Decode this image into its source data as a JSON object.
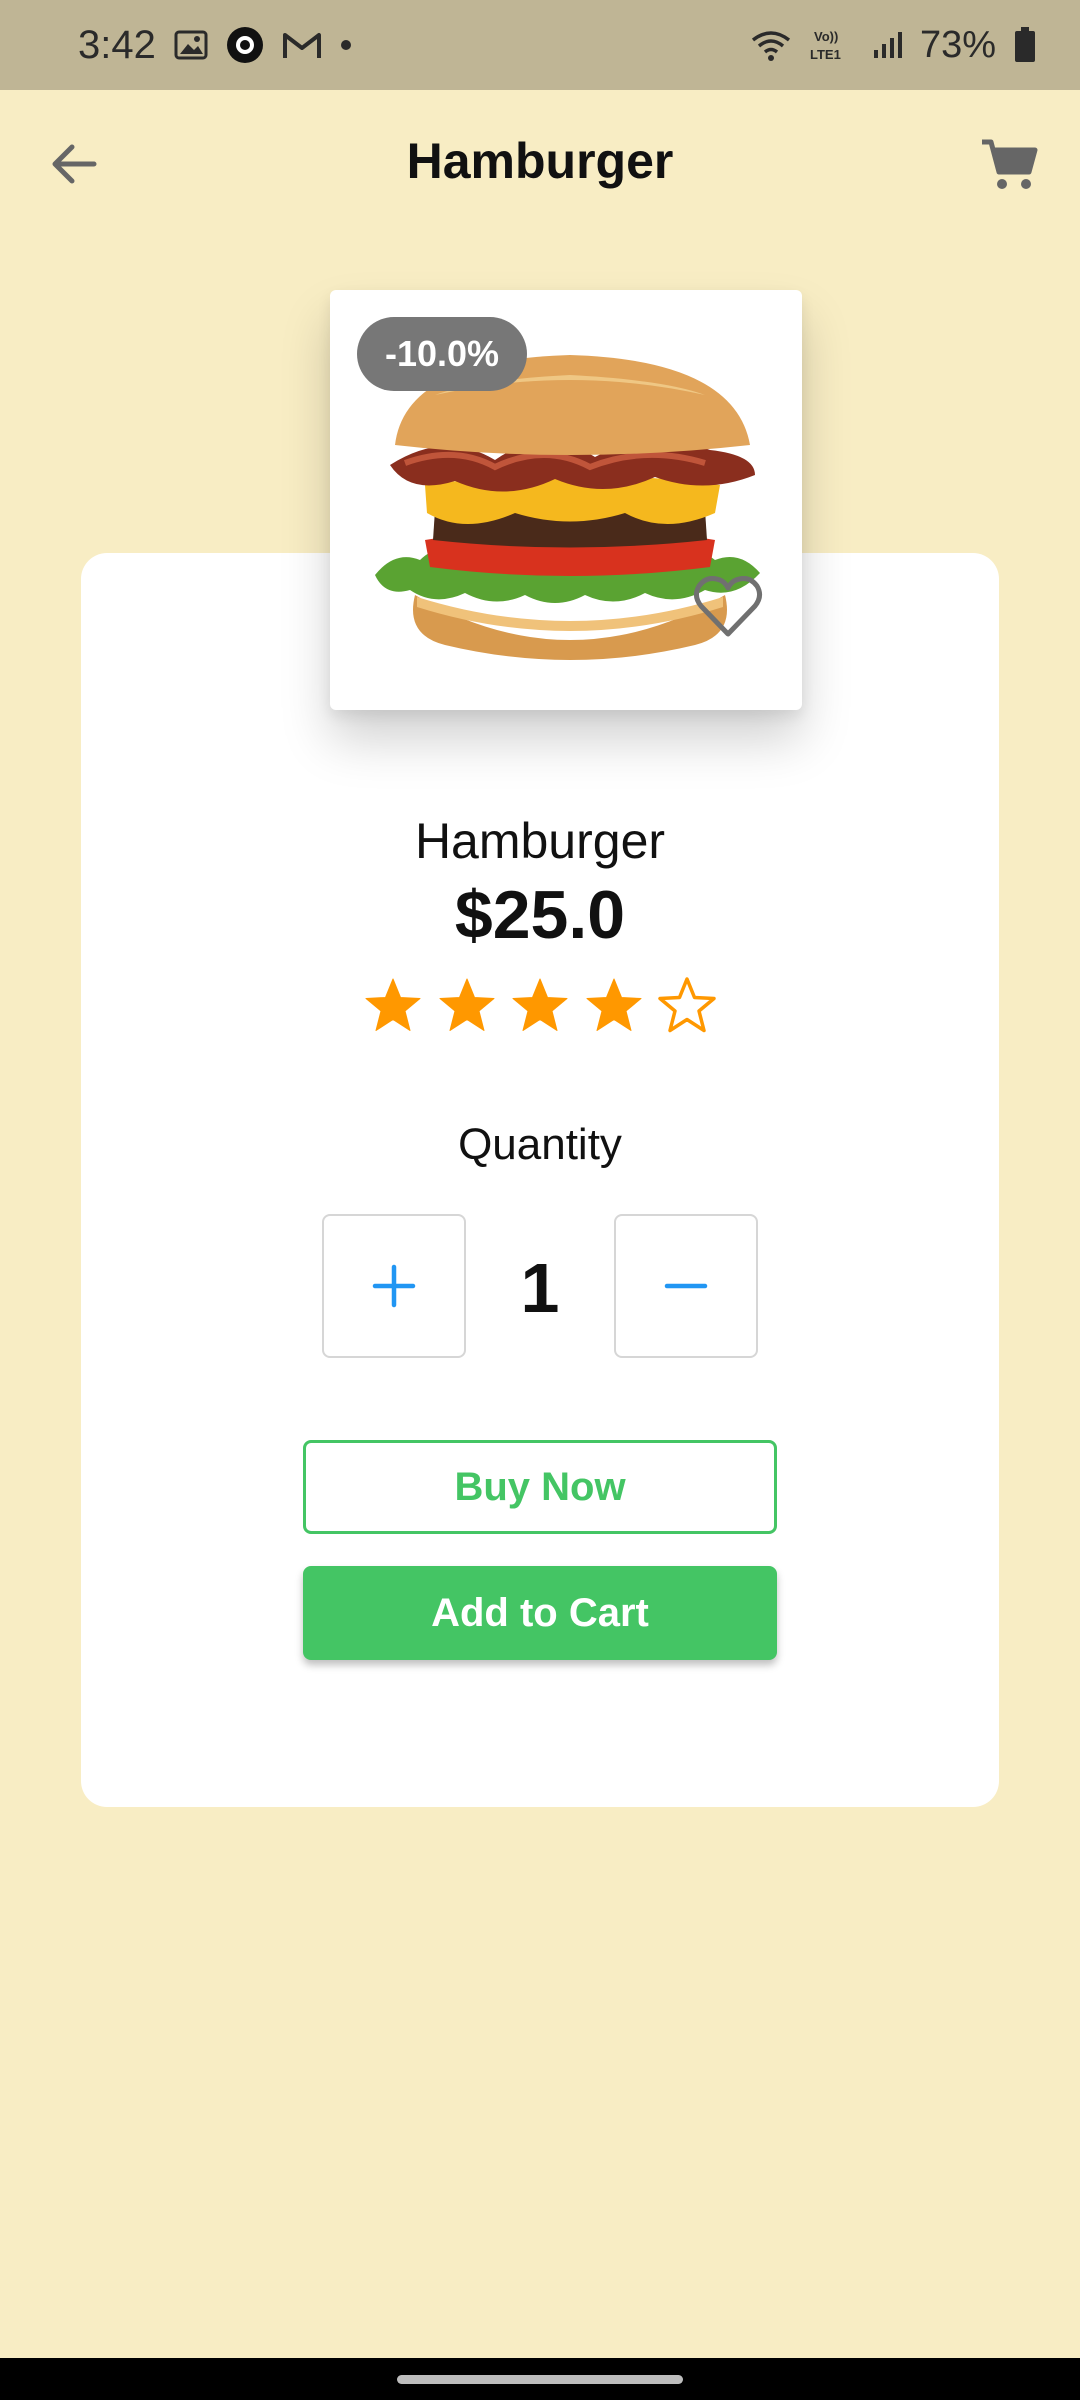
{
  "status_bar": {
    "time": "3:42",
    "battery": "73%",
    "icons": [
      "gallery-icon",
      "app-badge-icon",
      "gmail-icon",
      "dot-icon",
      "wifi-icon",
      "volte-icon",
      "signal-icon",
      "battery-icon"
    ]
  },
  "header": {
    "title": "Hamburger",
    "back_icon": "arrow-left-icon",
    "cart_icon": "shopping-cart-icon"
  },
  "product": {
    "discount": "-10.0%",
    "name": "Hamburger",
    "price": "$25.0",
    "rating": 4,
    "rating_max": 5,
    "favorite_icon": "heart-outline-icon"
  },
  "quantity": {
    "label": "Quantity",
    "value": "1",
    "plus_icon": "plus-icon",
    "minus_icon": "minus-icon"
  },
  "actions": {
    "buy_now": "Buy Now",
    "add_to_cart": "Add to Cart"
  },
  "colors": {
    "background": "#f8edc4",
    "status_bar": "#bfb595",
    "accent_green": "#44c564",
    "star": "#ff9800",
    "qty_icon": "#2196f3"
  }
}
